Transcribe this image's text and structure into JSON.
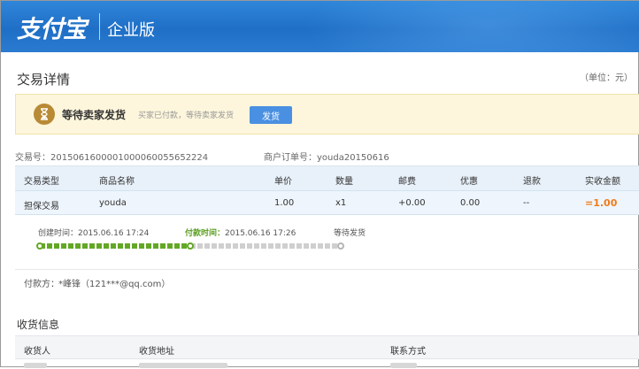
{
  "header": {
    "logo": "支付宝",
    "edition": "企业版"
  },
  "page": {
    "title": "交易详情",
    "unit": "（单位：元）"
  },
  "status": {
    "title": "等待卖家发货",
    "description": "买家已付款，等待卖家发货",
    "ship_button": "发货",
    "icon": "hourglass-icon"
  },
  "meta": {
    "trade_no_label": "交易号：",
    "trade_no": "2015061600001000060055652224",
    "order_no_label": "商户订单号：",
    "order_no": "youda20150616"
  },
  "table": {
    "headers": [
      "交易类型",
      "商品名称",
      "单价",
      "数量",
      "邮费",
      "优惠",
      "退款",
      "实收金额"
    ],
    "row": {
      "type": "担保交易",
      "name": "youda",
      "price": "1.00",
      "qty": "x1",
      "shipping": "+0.00",
      "discount": "0.00",
      "refund": "--",
      "amount": "=1.00"
    }
  },
  "timeline": {
    "created_label": "创建时间：",
    "created_time": "2015.06.16 17:24",
    "paid_label": "付款时间：",
    "paid_time": "2015.06.16 17:26",
    "waiting_label": "等待发货",
    "progress": 0.5,
    "colors": {
      "done": "#62a825",
      "pending": "#cfcfcf"
    }
  },
  "payer": {
    "label": "付款方：",
    "value": "*峰锋（121***@qq.com）"
  },
  "receive": {
    "title": "收货信息",
    "headers": [
      "收货人",
      "收货地址",
      "联系方式"
    ]
  }
}
